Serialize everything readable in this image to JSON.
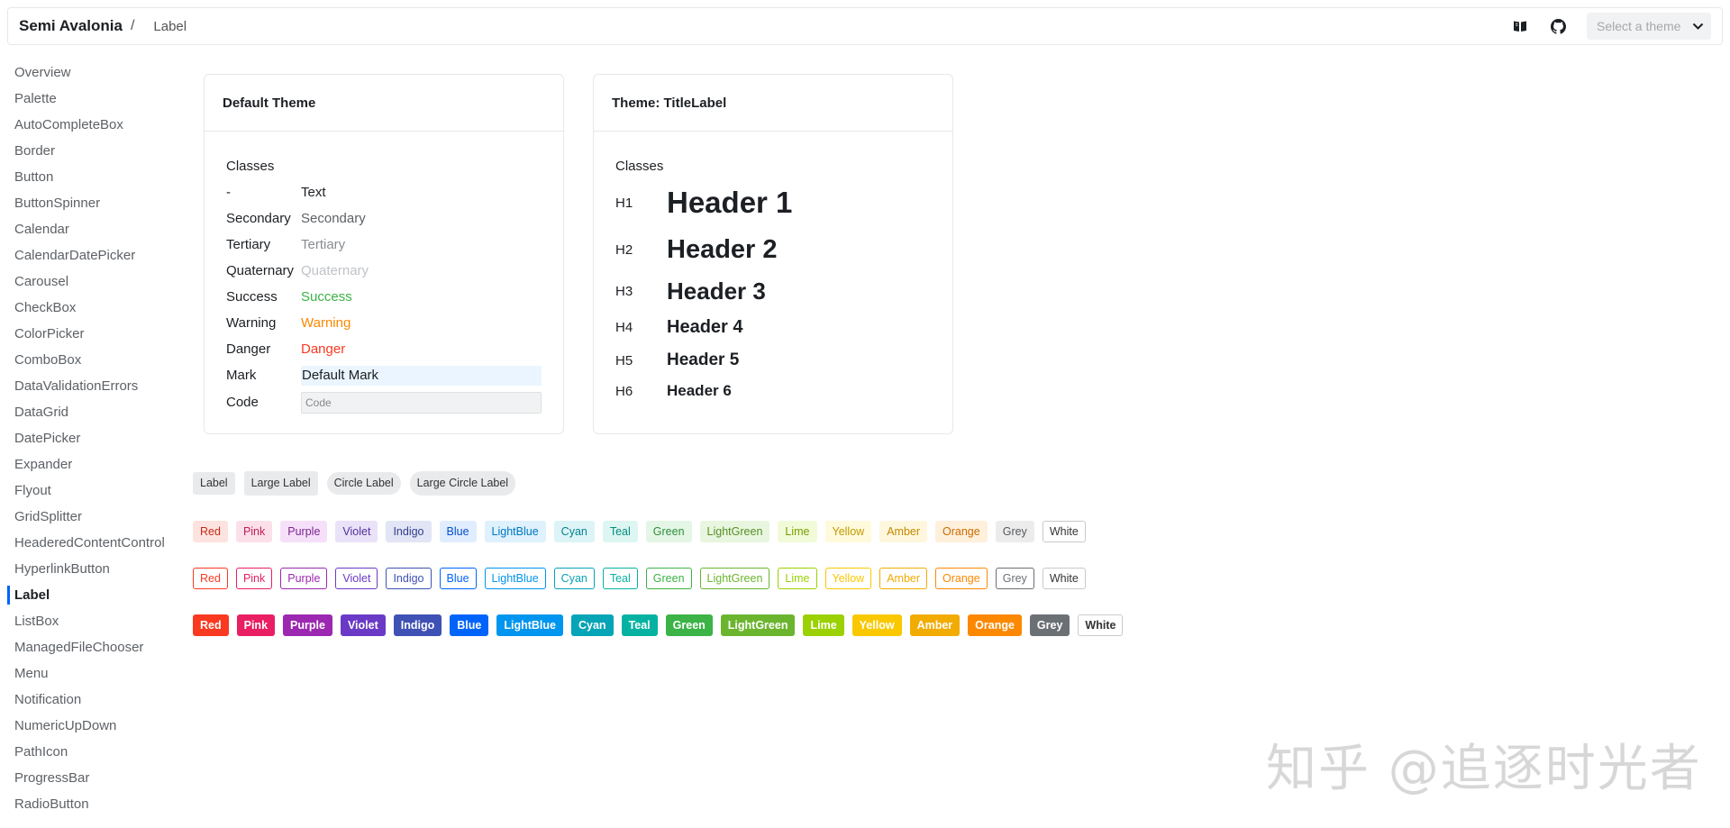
{
  "header": {
    "brand": "Semi Avalonia",
    "separator": "/",
    "breadcrumb": "Label",
    "theme_placeholder": "Select a theme"
  },
  "sidebar": {
    "active": "Label",
    "items": [
      "Overview",
      "Palette",
      "AutoCompleteBox",
      "Border",
      "Button",
      "ButtonSpinner",
      "Calendar",
      "CalendarDatePicker",
      "Carousel",
      "CheckBox",
      "ColorPicker",
      "ComboBox",
      "DataValidationErrors",
      "DataGrid",
      "DatePicker",
      "Expander",
      "Flyout",
      "GridSplitter",
      "HeaderedContentControl",
      "HyperlinkButton",
      "Label",
      "ListBox",
      "ManagedFileChooser",
      "Menu",
      "Notification",
      "NumericUpDown",
      "PathIcon",
      "ProgressBar",
      "RadioButton"
    ]
  },
  "default_card": {
    "title": "Default Theme",
    "classes_title": "Classes",
    "rows": [
      {
        "label": "-",
        "value": "Text",
        "color": "#1c1f23"
      },
      {
        "label": "Secondary",
        "value": "Secondary",
        "color": "#5d6166"
      },
      {
        "label": "Tertiary",
        "value": "Tertiary",
        "color": "#888d92"
      },
      {
        "label": "Quaternary",
        "value": "Quaternary",
        "color": "#bfc2c6"
      },
      {
        "label": "Success",
        "value": "Success",
        "color": "#3bb346"
      },
      {
        "label": "Warning",
        "value": "Warning",
        "color": "#fc8800"
      },
      {
        "label": "Danger",
        "value": "Danger",
        "color": "#f93920"
      }
    ],
    "mark": {
      "label": "Mark",
      "value": "Default Mark"
    },
    "code": {
      "label": "Code",
      "value": "Code"
    }
  },
  "title_card": {
    "title": "Theme: TitleLabel",
    "classes_title": "Classes",
    "headers": [
      {
        "level": "H1",
        "text": "Header 1"
      },
      {
        "level": "H2",
        "text": "Header 2"
      },
      {
        "level": "H3",
        "text": "Header 3"
      },
      {
        "level": "H4",
        "text": "Header 4"
      },
      {
        "level": "H5",
        "text": "Header 5"
      },
      {
        "level": "H6",
        "text": "Header 6"
      }
    ]
  },
  "label_strip": [
    "Label",
    "Large Label",
    "Circle Label",
    "Large Circle Label"
  ],
  "color_labels": {
    "names": [
      "Red",
      "Pink",
      "Purple",
      "Violet",
      "Indigo",
      "Blue",
      "LightBlue",
      "Cyan",
      "Teal",
      "Green",
      "LightGreen",
      "Lime",
      "Yellow",
      "Amber",
      "Orange",
      "Grey",
      "White"
    ],
    "solid": [
      "#f93920",
      "#e91e63",
      "#9c27b0",
      "#6a3ac7",
      "#3f51b5",
      "#0064fa",
      "#0095ee",
      "#05a4b6",
      "#05b2a2",
      "#3bb346",
      "#6bb52e",
      "#9bd100",
      "#fac800",
      "#f2ab00",
      "#fc8800",
      "#6b7075",
      "#ffffff"
    ],
    "light": [
      "#fde3df",
      "#fbe0ea",
      "#f6e0f9",
      "#e9e2f8",
      "#e2e5f5",
      "#e0edff",
      "#def1fd",
      "#ddf4f7",
      "#ddf6f2",
      "#e4f6e6",
      "#e9f6df",
      "#f2fbd9",
      "#fffadc",
      "#fef7de",
      "#fff0dc",
      "#ececed",
      "#ffffff"
    ],
    "light_text": [
      "#c42c18",
      "#c21a56",
      "#7c2590",
      "#54309f",
      "#323f8f",
      "#0050cc",
      "#0077bf",
      "#058291",
      "#048c80",
      "#2e8f38",
      "#559025",
      "#769f00",
      "#c29900",
      "#c28800",
      "#ca6c00",
      "#555a5e",
      "#333333"
    ]
  },
  "watermark": "知乎 @追逐时光者"
}
